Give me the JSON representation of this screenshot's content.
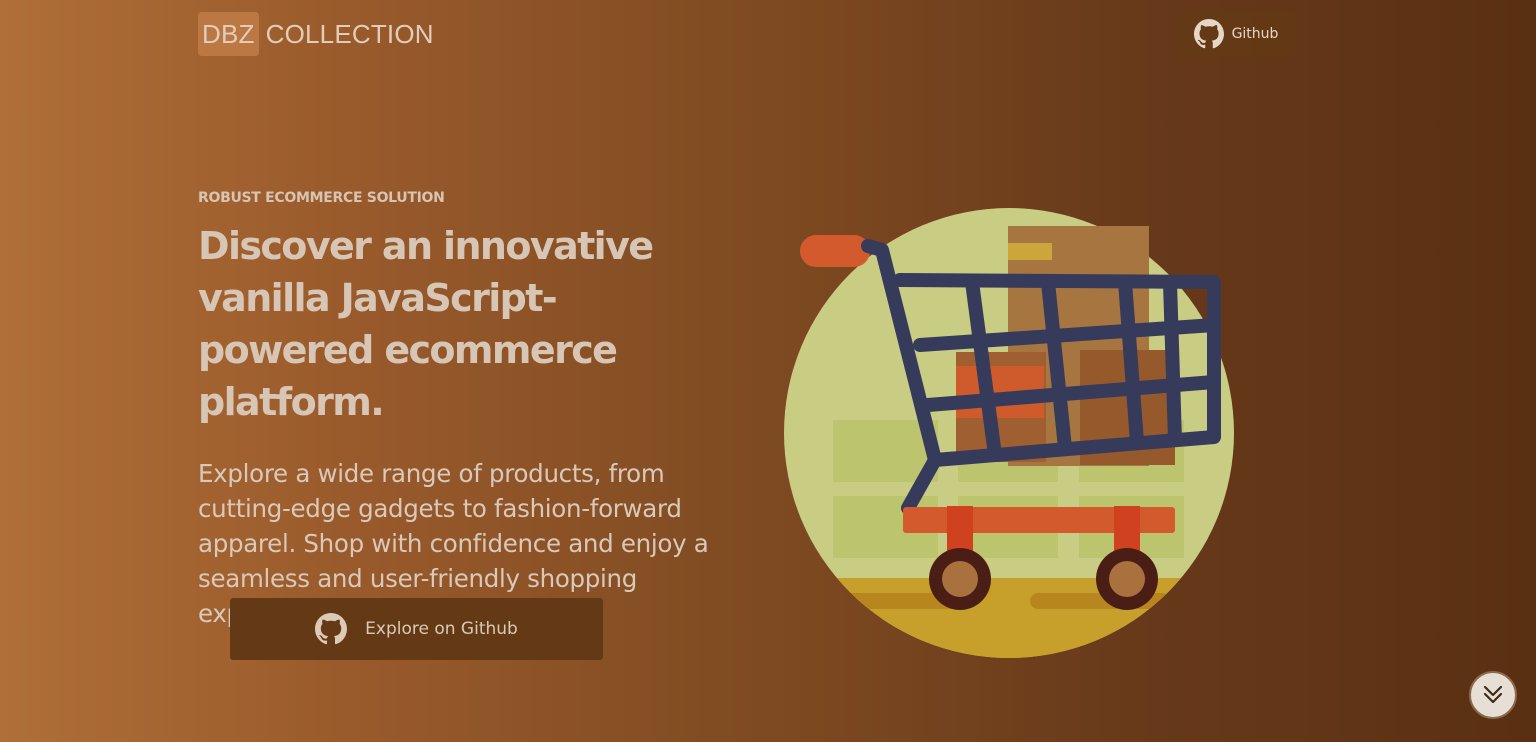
{
  "header": {
    "logo_badge": "DBZ",
    "logo_text": "COLLECTION",
    "github_label": "Github"
  },
  "hero": {
    "eyebrow": "ROBUST ECOMMERCE SOLUTION",
    "headline": "Discover an innovative vanilla JavaScript-powered ecommerce platform.",
    "description": "Explore a wide range of products, from cutting-edge gadgets to fashion-forward apparel. Shop with confidence and enjoy a seamless and user-friendly shopping experience.",
    "cta_label": "Explore on Github"
  },
  "icons": {
    "github": "github-icon",
    "scroll": "double-chevron-down-icon",
    "illustration": "shopping-cart-illustration"
  },
  "colors": {
    "gradient_left": "#b06f38",
    "gradient_right": "#5a3012",
    "cta_background": "#633a15",
    "text": "#d9c9bb"
  }
}
